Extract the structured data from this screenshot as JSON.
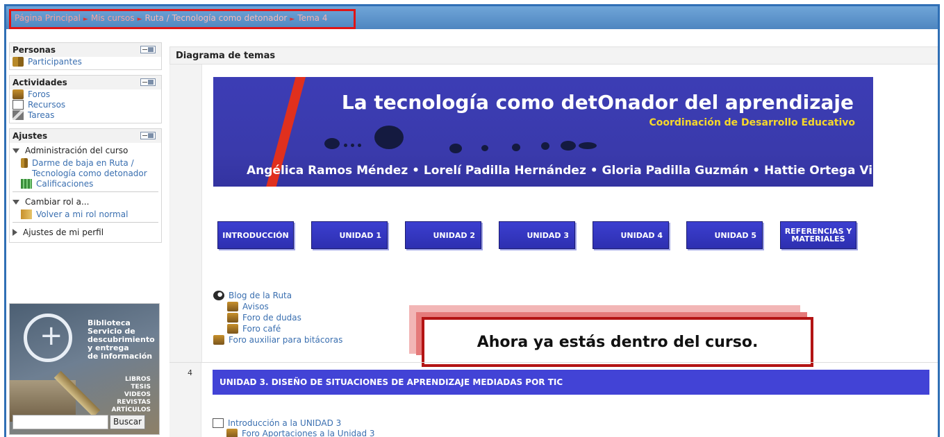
{
  "breadcrumb": {
    "items": [
      "Página Principal",
      "Mis cursos",
      "Ruta / Tecnología como detonador",
      "Tema 4"
    ]
  },
  "sidebar": {
    "personas": {
      "title": "Personas",
      "items": [
        "Participantes"
      ]
    },
    "actividades": {
      "title": "Actividades",
      "items": [
        "Foros",
        "Recursos",
        "Tareas"
      ]
    },
    "ajustes": {
      "title": "Ajustes",
      "admin": "Administración del curso",
      "unenrol": "Darme de baja en Ruta / Tecnología como detonador",
      "grades": "Calificaciones",
      "switch_role": "Cambiar rol a...",
      "return_role": "Volver a mi rol normal",
      "profile": "Ajustes de mi perfil"
    },
    "library": {
      "title": "Biblioteca\nServicio de\ndescubrimiento\ny entrega\nde información",
      "types": "LIBROS\nTESIS\nVIDEOS\nREVISTAS\nARTÍCULOS",
      "search_value": "",
      "button": "Buscar"
    }
  },
  "main": {
    "heading": "Diagrama de temas",
    "banner": {
      "title": "La tecnología como detOnador del aprendizaje",
      "subtitle": "Coordinación de Desarrollo Educativo",
      "authors": "Angélica Ramos Méndez • Lorelí Padilla Hernández • Gloria Padilla Guzmán • Hattie Ortega Villaseñor"
    },
    "units": [
      "INTRODUCCIÓN",
      "UNIDAD 1",
      "UNIDAD 2",
      "UNIDAD 3",
      "UNIDAD 4",
      "UNIDAD 5",
      "REFERENCIAS Y MATERIALES"
    ],
    "links": {
      "blog": "Blog de la Ruta",
      "avisos": "Avisos",
      "dudas": "Foro de dudas",
      "cafe": "Foro café",
      "bitacoras": "Foro auxiliar para bitácoras"
    },
    "callout": "Ahora ya estás dentro del curso.",
    "section4": {
      "number": "4",
      "title": "UNIDAD 3. DISEÑO DE SITUACIONES DE APRENDIZAJE MEDIADAS POR TIC",
      "intro": "Introducción a la UNIDAD 3",
      "forum": "Foro Aportaciones a la Unidad 3"
    }
  },
  "colors": {
    "topbar": "#4f86c0",
    "highlight_box": "#e01414",
    "banner_blue": "#3a3aab",
    "unit_button": "#2d2fb0",
    "link": "#3a6fb0"
  }
}
